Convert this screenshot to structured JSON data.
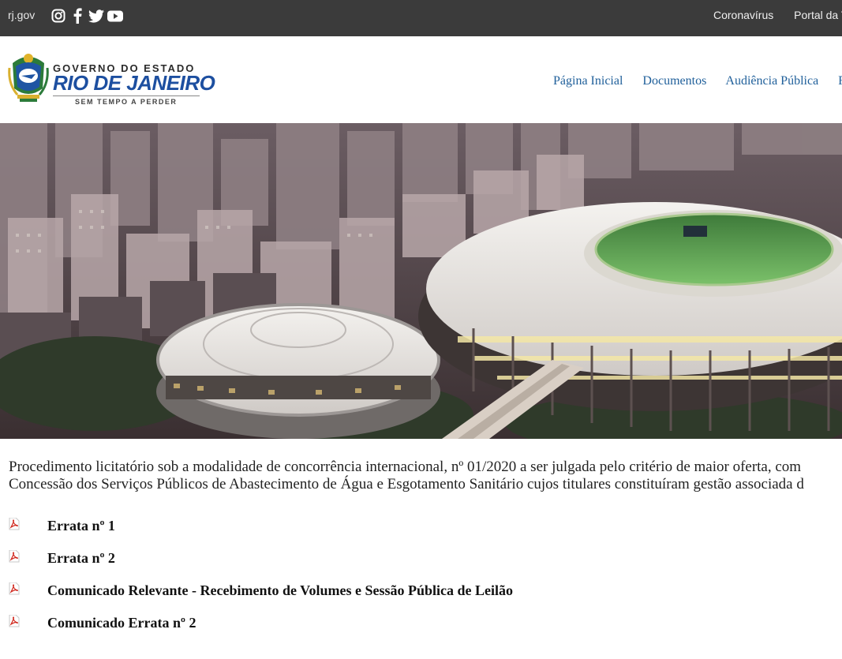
{
  "topbar": {
    "site": "rj.gov",
    "social_icons": [
      "instagram-icon",
      "facebook-icon",
      "twitter-icon",
      "youtube-icon"
    ],
    "links": [
      "Coronavírus",
      "Portal da T"
    ]
  },
  "header": {
    "logo": {
      "line1": "GOVERNO DO ESTADO",
      "line2": "RIO DE JANEIRO",
      "line3": "SEM TEMPO A PERDER"
    },
    "nav": [
      "Página Inicial",
      "Documentos",
      "Audiência Pública",
      "F"
    ]
  },
  "hero": {
    "description": "Aerial view of stadiums in Rio de Janeiro"
  },
  "intro": {
    "line1": "Procedimento licitatório sob a modalidade de concorrência internacional, nº 01/2020 a ser julgada pelo critério de maior oferta, com",
    "line2": "Concessão dos Serviços Públicos de Abastecimento de Água e Esgotamento Sanitário cujos titulares constituíram gestão associada d"
  },
  "documents": [
    {
      "label": "Errata nº 1",
      "icon": "pdf-icon"
    },
    {
      "label": "Errata nº 2",
      "icon": "pdf-icon"
    },
    {
      "label": "Comunicado Relevante - Recebimento de Volumes e Sessão Pública de Leilão",
      "icon": "pdf-icon"
    },
    {
      "label": "Comunicado Errata nº 2",
      "icon": "pdf-icon"
    }
  ],
  "colors": {
    "topbar_bg": "#3b3b3b",
    "nav_link": "#1f5f9a",
    "logo_blue": "#1d4fa0"
  }
}
